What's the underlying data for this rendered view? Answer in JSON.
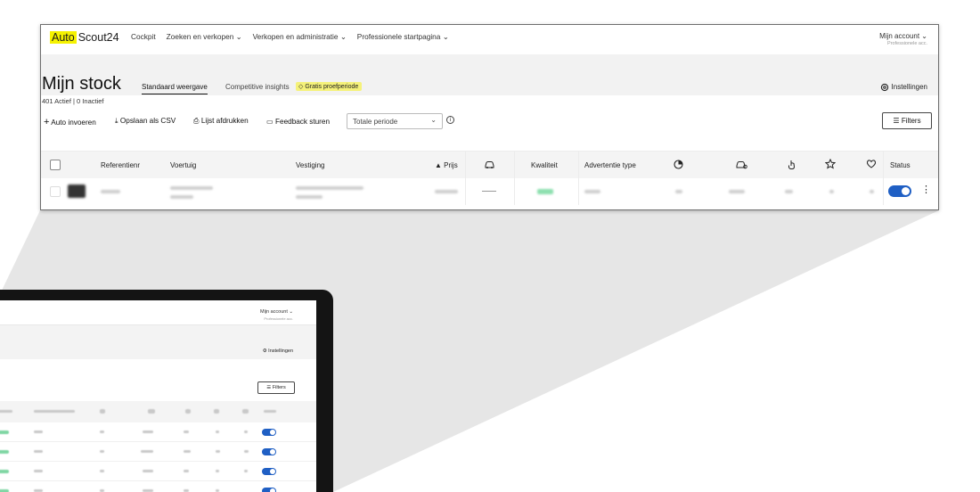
{
  "colors": {
    "brand_yellow": "#f5f200",
    "badge_yellow": "#f5f27a",
    "toggle_blue": "#1f5fc4",
    "quality_green": "#8ee0b0"
  },
  "brand": {
    "auto": "Auto",
    "scout": "Scout24"
  },
  "nav": {
    "items": [
      "Cockpit",
      "Zoeken en verkopen ⌄",
      "Verkopen en administratie ⌄",
      "Professionele startpagina ⌄"
    ]
  },
  "account": {
    "label": "Mijn account ⌄",
    "sub": "Professionele acc."
  },
  "page": {
    "title": "Mijn stock",
    "counts": "401 Actief  |  0 Inactief",
    "tabs": [
      "Standaard weergave",
      "Competitive insights"
    ],
    "badge": "Gratis proefperiode",
    "settings": "Instellingen"
  },
  "toolbar": {
    "add": "Auto invoeren",
    "csv": "Opslaan als CSV",
    "print": "Lijst afdrukken",
    "feedback": "Feedback sturen",
    "period": "Totale periode",
    "filters": "Filters"
  },
  "table": {
    "headers": {
      "ref": "Referentienr",
      "vehicle": "Voertuig",
      "branch": "Vestiging",
      "price": "▲ Prijs",
      "quality": "Kwaliteit",
      "adtype": "Advertentie type",
      "status": "Status"
    },
    "icons": [
      "car-icon",
      "pie-chart-icon",
      "car-view-icon",
      "click-icon",
      "star-icon",
      "heart-hand-icon"
    ]
  },
  "laptop": {
    "account": {
      "label": "Mijn account ⌄",
      "sub": "Professionele acc."
    },
    "settings": "Instellingen",
    "filters": "Filters"
  }
}
